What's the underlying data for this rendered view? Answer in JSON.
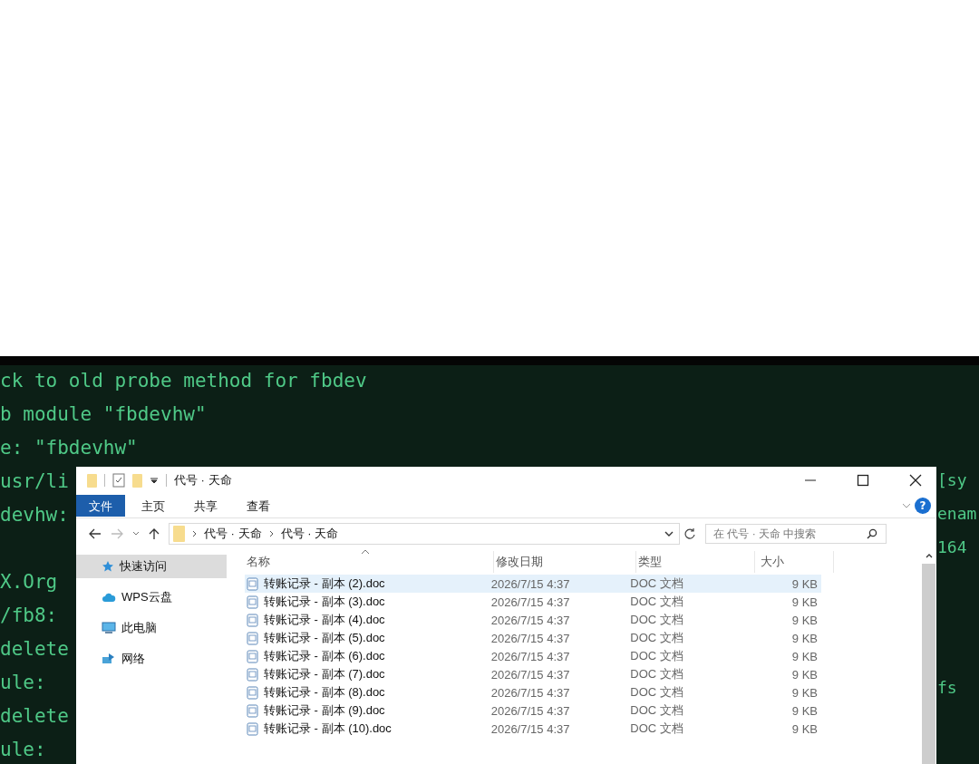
{
  "terminal": {
    "lines": [
      "ck to old probe method for fbdev",
      "b module \"fbdevhw\"",
      "e: \"fbdevhw\"",
      "usr/li",
      "devhw:",
      "X.Org",
      "/fb8:",
      "delete",
      "ule:",
      "delete",
      "ule:"
    ],
    "right_top_lines": [
      "[sy",
      "enam",
      "164"
    ],
    "right_bottom_lines": [
      "fs"
    ]
  },
  "window": {
    "title": "代号 · 天命",
    "help_label": "?"
  },
  "ribbon_tabs": [
    {
      "label": "文件",
      "selected": true
    },
    {
      "label": "主页",
      "selected": false
    },
    {
      "label": "共享",
      "selected": false
    },
    {
      "label": "查看",
      "selected": false
    }
  ],
  "address_bar": {
    "path": [
      "代号 · 天命",
      "代号 · 天命"
    ]
  },
  "search": {
    "placeholder": "在 代号 · 天命 中搜索"
  },
  "sidebar": {
    "items": [
      {
        "label": "快速访问",
        "selected": true
      },
      {
        "label": "WPS云盘",
        "selected": false
      },
      {
        "label": "此电脑",
        "selected": false
      },
      {
        "label": "网络",
        "selected": false
      }
    ]
  },
  "table": {
    "columns": [
      "名称",
      "修改日期",
      "类型",
      "大小"
    ],
    "rows": [
      {
        "name": "转账记录 - 副本 (2).doc",
        "date": "2026/7/15 4:37",
        "type": "DOC 文档",
        "size": "9 KB",
        "selected": true
      },
      {
        "name": "转账记录 - 副本 (3).doc",
        "date": "2026/7/15 4:37",
        "type": "DOC 文档",
        "size": "9 KB",
        "selected": false
      },
      {
        "name": "转账记录 - 副本 (4).doc",
        "date": "2026/7/15 4:37",
        "type": "DOC 文档",
        "size": "9 KB",
        "selected": false
      },
      {
        "name": "转账记录 - 副本 (5).doc",
        "date": "2026/7/15 4:37",
        "type": "DOC 文档",
        "size": "9 KB",
        "selected": false
      },
      {
        "name": "转账记录 - 副本 (6).doc",
        "date": "2026/7/15 4:37",
        "type": "DOC 文档",
        "size": "9 KB",
        "selected": false
      },
      {
        "name": "转账记录 - 副本 (7).doc",
        "date": "2026/7/15 4:37",
        "type": "DOC 文档",
        "size": "9 KB",
        "selected": false
      },
      {
        "name": "转账记录 - 副本 (8).doc",
        "date": "2026/7/15 4:37",
        "type": "DOC 文档",
        "size": "9 KB",
        "selected": false
      },
      {
        "name": "转账记录 - 副本 (9).doc",
        "date": "2026/7/15 4:37",
        "type": "DOC 文档",
        "size": "9 KB",
        "selected": false
      },
      {
        "name": "转账记录 - 副本 (10).doc",
        "date": "2026/7/15 4:37",
        "type": "DOC 文档",
        "size": "9 KB",
        "selected": false
      }
    ]
  }
}
